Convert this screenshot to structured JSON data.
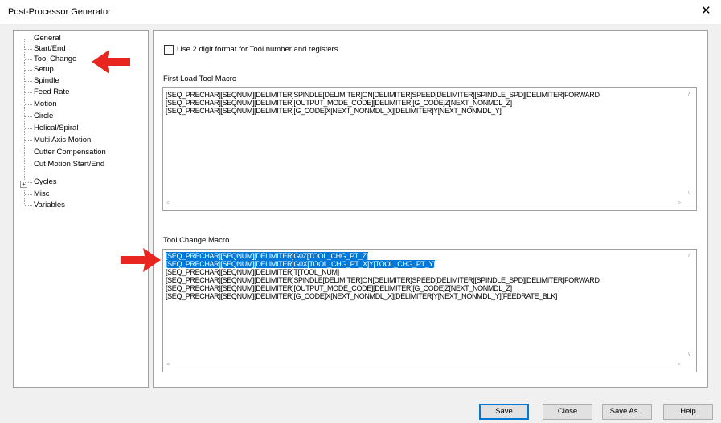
{
  "window": {
    "title": "Post-Processor Generator",
    "close_glyph": "✕"
  },
  "tree": {
    "items": [
      {
        "label": "General"
      },
      {
        "label": "Start/End"
      },
      {
        "label": "Tool Change"
      },
      {
        "label": "Setup"
      },
      {
        "label": "Spindle"
      },
      {
        "label": "Feed Rate"
      },
      {
        "label": "Motion"
      },
      {
        "label": "Circle"
      },
      {
        "label": "Helical/Spiral"
      },
      {
        "label": "Multi Axis Motion"
      },
      {
        "label": "Cutter Compensation"
      },
      {
        "label": "Cut Motion Start/End"
      },
      {
        "label": "Cycles",
        "expander": "+"
      },
      {
        "label": "Misc"
      },
      {
        "label": "Variables"
      }
    ]
  },
  "main": {
    "checkbox_label": "Use 2 digit format for Tool number and registers",
    "first_load": {
      "label": "First Load Tool Macro",
      "lines": [
        "[SEQ_PRECHAR][SEQNUM][DELIMITER]SPINDLE[DELIMITER]ON[DELIMITER]SPEED[DELIMITER][SPINDLE_SPD][DELIMITER]FORWARD",
        "[SEQ_PRECHAR][SEQNUM][DELIMITER][OUTPUT_MODE_CODE][DELIMITER][G_CODE]Z[NEXT_NONMDL_Z]",
        "[SEQ_PRECHAR][SEQNUM][DELIMITER][G_CODE]X[NEXT_NONMDL_X][DELIMITER]Y[NEXT_NONMDL_Y]"
      ]
    },
    "tool_change": {
      "label": "Tool Change Macro",
      "lines": [
        "[SEQ_PRECHAR][SEQNUM][DELIMITER]G0Z[TOOL_CHG_PT_Z]",
        "[SEQ_PRECHAR][SEQNUM][DELIMITER]G0X[TOOL_CHG_PT_X]Y[TOOL_CHG_PT_Y]",
        "[SEQ_PRECHAR][SEQNUM][DELIMITER]T[TOOL_NUM]",
        "[SEQ_PRECHAR][SEQNUM][DELIMITER]SPINDLE[DELIMITER]ON[DELIMITER]SPEED[DELIMITER][SPINDLE_SPD][DELIMITER]FORWARD",
        "[SEQ_PRECHAR][SEQNUM][DELIMITER][OUTPUT_MODE_CODE][DELIMITER][G_CODE]Z[NEXT_NONMDL_Z]",
        "[SEQ_PRECHAR][SEQNUM][DELIMITER][G_CODE]X[NEXT_NONMDL_X][DELIMITER]Y[NEXT_NONMDL_Y][FEEDRATE_BLK]"
      ]
    }
  },
  "scroll_glyphs": {
    "up": "∧",
    "down": "∨",
    "left": "<",
    "right": ">"
  },
  "buttons": {
    "save": "Save",
    "close": "Close",
    "save_as": "Save As...",
    "help": "Help"
  },
  "annotation_color": "#e8261f",
  "selection_color": "#0078d7"
}
